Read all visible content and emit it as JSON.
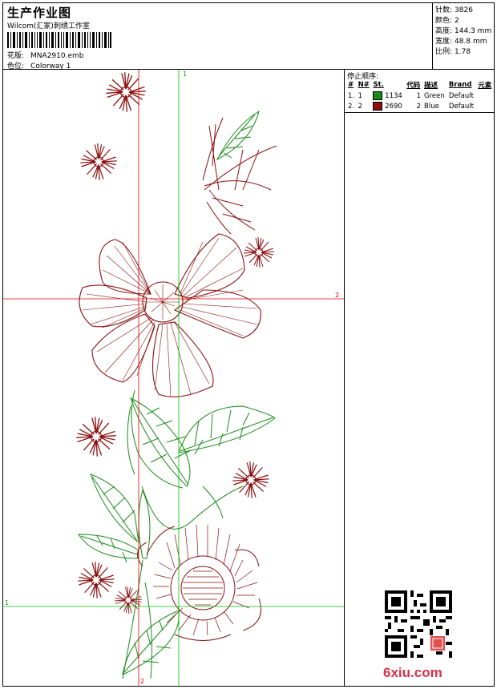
{
  "header": {
    "title": "生产作业图",
    "studio": "Wilcom(汇家)刺绣工作室",
    "design_label": "花版:",
    "design_value": "MNA2910.emb",
    "colorway_label": "色位:",
    "colorway_value": "Colorway 1"
  },
  "stats": [
    {
      "label": "针数:",
      "value": "3826"
    },
    {
      "label": "颜色:",
      "value": "2"
    },
    {
      "label": "高度:",
      "value": "144.3 mm"
    },
    {
      "label": "宽度:",
      "value": "48.8 mm"
    },
    {
      "label": "比例:",
      "value": "1.78"
    }
  ],
  "stop_sequence": {
    "title": "停止顺序:",
    "headers": [
      "#",
      "N#",
      "St.",
      "代码",
      "描述",
      "Brand",
      "元素"
    ],
    "rows": [
      {
        "num": "1.",
        "n": "1",
        "color_hex": "#1a8a1a",
        "code": "1134",
        "st": "1",
        "desc": "Green",
        "brand": "Default"
      },
      {
        "num": "2.",
        "n": "2",
        "color_hex": "#8b1010",
        "code": "2690",
        "st": "2",
        "desc": "Blue",
        "brand": "Default"
      }
    ]
  },
  "axes": {
    "v_top_label": "1",
    "v_bottom_label": "2",
    "h_left_label": "1",
    "h_right_label": "2"
  },
  "colors": {
    "thread_green": "#1a8a1a",
    "thread_red": "#8b1010",
    "guide_red": "#e00000",
    "guide_green": "#00c000"
  },
  "watermark": "6xiu.com"
}
